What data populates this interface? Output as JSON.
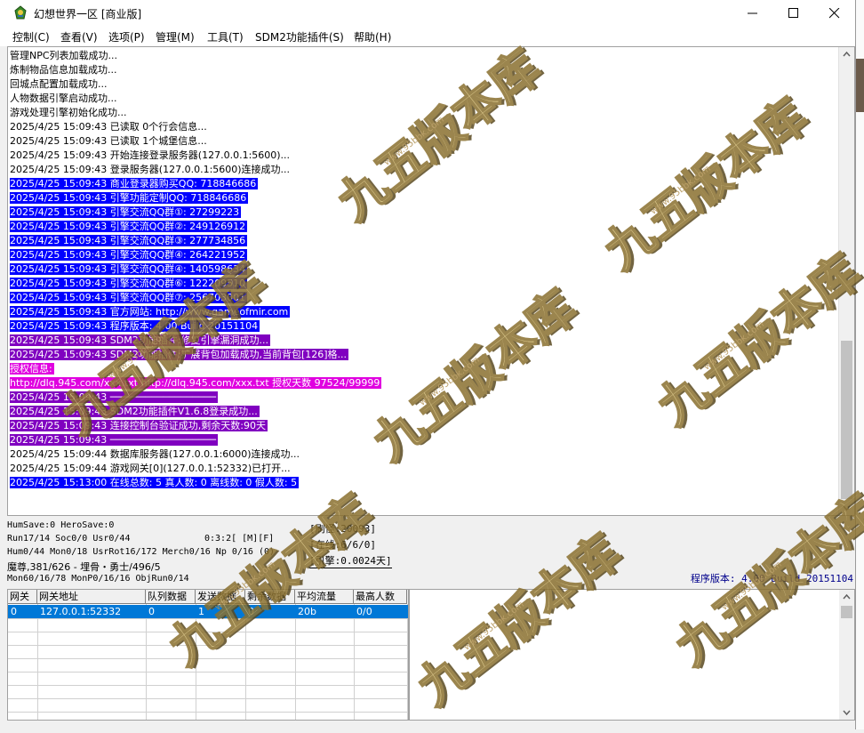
{
  "window": {
    "title": "幻想世界一区 [商业版]",
    "controls": [
      "minimize-icon",
      "maximize-icon",
      "close-icon"
    ]
  },
  "menu": [
    "控制(C)",
    "查看(V)",
    "选项(P)",
    "管理(M)",
    "工具(T)",
    "SDM2功能插件(S)",
    "帮助(H)"
  ],
  "log": [
    {
      "text": "管理NPC列表加载成功...",
      "style": "plain"
    },
    {
      "text": "炼制物品信息加载成功...",
      "style": "plain"
    },
    {
      "text": "回城点配置加载成功...",
      "style": "plain"
    },
    {
      "text": "人物数据引擎启动成功...",
      "style": "plain"
    },
    {
      "text": "游戏处理引擎初始化成功...",
      "style": "plain"
    },
    {
      "text": "2025/4/25 15:09:43 已读取 0个行会信息...",
      "style": "plain"
    },
    {
      "text": "2025/4/25 15:09:43 已读取 1个城堡信息...",
      "style": "plain"
    },
    {
      "text": "2025/4/25 15:09:43 开始连接登录服务器(127.0.0.1:5600)...",
      "style": "plain"
    },
    {
      "text": "2025/4/25 15:09:43 登录服务器(127.0.0.1:5600)连接成功...",
      "style": "plain"
    },
    {
      "text": "2025/4/25 15:09:43 商业登录器购买QQ: 718846686",
      "style": "blue"
    },
    {
      "text": "2025/4/25 15:09:43 引擎功能定制QQ: 718846686",
      "style": "blue"
    },
    {
      "text": "2025/4/25 15:09:43 引擎交流QQ群①: 27299223",
      "style": "blue"
    },
    {
      "text": "2025/4/25 15:09:43 引擎交流QQ群②: 249126912",
      "style": "blue"
    },
    {
      "text": "2025/4/25 15:09:43 引擎交流QQ群③: 277734856",
      "style": "blue"
    },
    {
      "text": "2025/4/25 15:09:43 引擎交流QQ群④: 264221952",
      "style": "blue"
    },
    {
      "text": "2025/4/25 15:09:43 引擎交流QQ群④: 140598634",
      "style": "blue"
    },
    {
      "text": "2025/4/25 15:09:43 引擎交流QQ群⑥: 122209510",
      "style": "blue"
    },
    {
      "text": "2025/4/25 15:09:43 引擎交流QQ群⑦: 256703001",
      "style": "blue"
    },
    {
      "text": "2025/4/25 15:09:43 官方网站: http://www.gameofmir.com",
      "style": "blue"
    },
    {
      "text": "2025/4/25 15:09:43 程序版本: 4.00 Build 20151104",
      "style": "blue"
    },
    {
      "text": "2025/4/25 15:09:43 SDM2功能插件:修复引擎漏洞成功...",
      "style": "purple"
    },
    {
      "text": "2025/4/25 15:09:43 SDM2功能插件:扩展背包加载成功,当前背包[126]格...",
      "style": "purple"
    },
    {
      "text": "授权信息:",
      "style": "magenta"
    },
    {
      "text": "http://dlq.945.com/xxx.txt http://dlq.945.com/xxx.txt 授权天数 97524/99999",
      "style": "magenta"
    },
    {
      "text": "2025/4/25 15:09:43 ──────────────────",
      "style": "purple"
    },
    {
      "text": "2025/4/25 15:09:43 SDM2功能插件V1.6.8登录成功...",
      "style": "purple"
    },
    {
      "text": "2025/4/25 15:09:43 连接控制台验证成功,剩余天数:90天",
      "style": "purple"
    },
    {
      "text": "2025/4/25 15:09:43 ──────────────────",
      "style": "purple"
    },
    {
      "text": "2025/4/25 15:09:44 数据库服务器(127.0.0.1:6000)连接成功...",
      "style": "plain"
    },
    {
      "text": "2025/4/25 15:09:44 游戏网关[0](127.0.0.1:52332)已打开...",
      "style": "plain"
    },
    {
      "text": "2025/4/25 15:13:00 在线总数: 5 真人数: 0 离线数: 0 假人数: 5",
      "style": "blue"
    }
  ],
  "status": {
    "line1": "HumSave:0 HeroSave:0",
    "line2": "Run17/14 Soc0/0 Usr0/44",
    "line2b": "0:3:2[  [M][F]",
    "line3": "Hum0/44 Mon0/18 UsrRot16/172 Merch0/16 Np 0/16 (0)",
    "line4": "魔尊,381/626 - 埋骨・勇士/496/5",
    "line5": "Mon60/16/78 MonP0/16/16 ObjRun0/14",
    "refresh": "[刷怪:20093]",
    "online": "[在线:6/6/0]",
    "engine": "[引擎:0.0024天]",
    "version": "程序版本: 4.00 Build 20151104"
  },
  "gateway_table": {
    "headers": [
      "网关",
      "网关地址",
      "队列数据",
      "发送数据",
      "剩余数据",
      "平均流量",
      "最高人数"
    ],
    "rows": [
      [
        "0",
        "127.0.0.1:52332",
        "0",
        "1",
        "0",
        "20b",
        "0/0"
      ]
    ]
  },
  "watermark": {
    "text": "九五版本库",
    "url": "www.95bbk.com"
  }
}
